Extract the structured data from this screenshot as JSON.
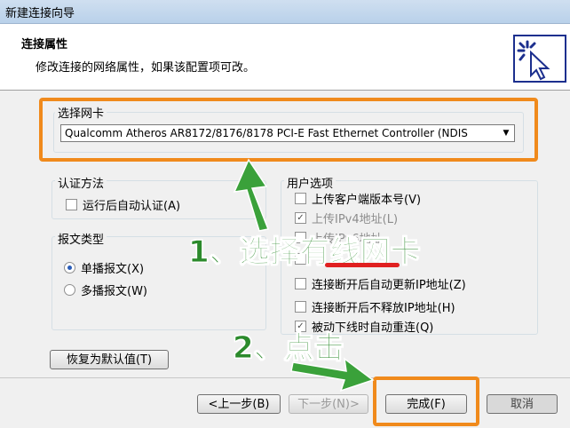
{
  "window": {
    "title": "新建连接向导"
  },
  "header": {
    "title": "连接属性",
    "subtitle": "修改连接的网络属性，如果该配置项可改。"
  },
  "nic": {
    "group_label": "选择网卡",
    "selected": "Qualcomm Atheros AR8172/8176/8178 PCI-E Fast Ethernet Controller (NDIS"
  },
  "auth": {
    "group_label": "认证方法",
    "auto_auth": {
      "label": "运行后自动认证(A)",
      "checked": false
    }
  },
  "packet": {
    "group_label": "报文类型",
    "unicast": {
      "label": "单播报文(X)",
      "selected": true
    },
    "multicast": {
      "label": "多播报文(W)",
      "selected": false
    }
  },
  "user_options": {
    "group_label": "用户选项",
    "items": [
      {
        "label": "上传客户端版本号(V)",
        "checked": false,
        "disabled": false
      },
      {
        "label": "上传IPv4地址(L)",
        "checked": true,
        "disabled": true
      },
      {
        "label": "上传IPv6地址",
        "checked": false,
        "disabled": true
      },
      {
        "label": "",
        "checked": false,
        "disabled": false
      },
      {
        "label": "连接断开后自动更新IP地址(Z)",
        "checked": false,
        "disabled": false
      },
      {
        "label": "连接断开后不释放IP地址(H)",
        "checked": false,
        "disabled": false
      },
      {
        "label": "被动下线时自动重连(Q)",
        "checked": true,
        "disabled": false
      }
    ]
  },
  "buttons": {
    "restore_defaults": "恢复为默认值(T)",
    "back": "<上一步(B)",
    "next": "下一步(N)>",
    "finish": "完成(F)",
    "cancel": "取消"
  },
  "annotations": {
    "step1": "1、选择有线网卡",
    "step2": "2、点击"
  },
  "colors": {
    "highlight": "#f08a1c",
    "annotation_text": "#2b8a2b",
    "underline": "#e02020"
  }
}
